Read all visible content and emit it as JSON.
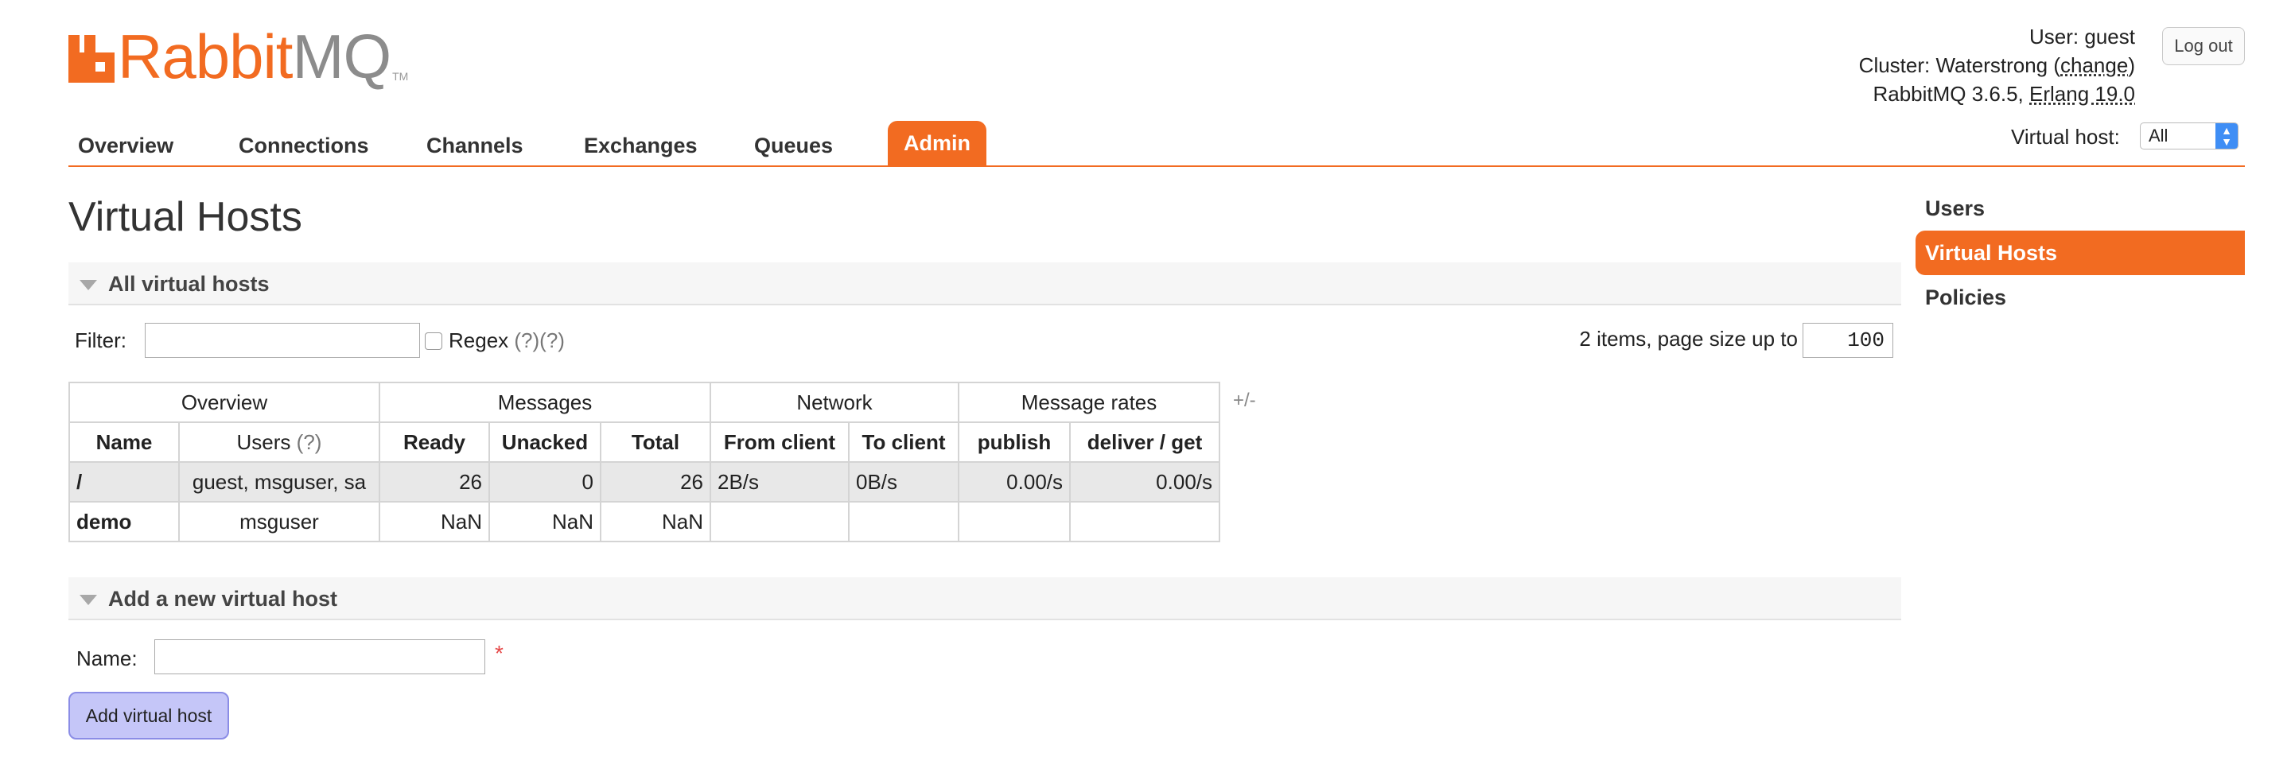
{
  "brand": {
    "name_main": "Rabbit",
    "name_suffix": "MQ",
    "tm": "TM",
    "accent": "#f26b21"
  },
  "user_info": {
    "user_label": "User:",
    "user": "guest",
    "cluster_label": "Cluster:",
    "cluster": "Waterstrong",
    "change_link": "change",
    "version": "RabbitMQ 3.6.5,",
    "erlang": "Erlang 19.0"
  },
  "logout_label": "Log out",
  "nav": {
    "items": [
      "Overview",
      "Connections",
      "Channels",
      "Exchanges",
      "Queues",
      "Admin"
    ],
    "active": "Admin"
  },
  "vhost_selector": {
    "label": "Virtual host:",
    "value": "All"
  },
  "side_menu": {
    "items": [
      "Users",
      "Virtual Hosts",
      "Policies"
    ],
    "active": "Virtual Hosts"
  },
  "page_title": "Virtual Hosts",
  "section_all": "All virtual hosts",
  "filter": {
    "label": "Filter:",
    "value": "",
    "regex_label": "Regex",
    "hint1": "(?)",
    "hint2": "(?)"
  },
  "paging": {
    "text": "2 items, page size up to",
    "page_size": "100"
  },
  "table": {
    "groups": [
      "Overview",
      "Messages",
      "Network",
      "Message rates"
    ],
    "columns": [
      "Name",
      "Users",
      "Ready",
      "Unacked",
      "Total",
      "From client",
      "To client",
      "publish",
      "deliver / get"
    ],
    "users_hint": "(?)",
    "rows": [
      [
        "/",
        "guest, msguser, sa",
        "26",
        "0",
        "26",
        "2B/s",
        "0B/s",
        "0.00/s",
        "0.00/s"
      ],
      [
        "demo",
        "msguser",
        "NaN",
        "NaN",
        "NaN",
        "",
        "",
        "",
        ""
      ]
    ],
    "plus_minus": "+/-"
  },
  "section_add": "Add a new virtual host",
  "add_form": {
    "name_label": "Name:",
    "required": "*",
    "button": "Add virtual host"
  }
}
